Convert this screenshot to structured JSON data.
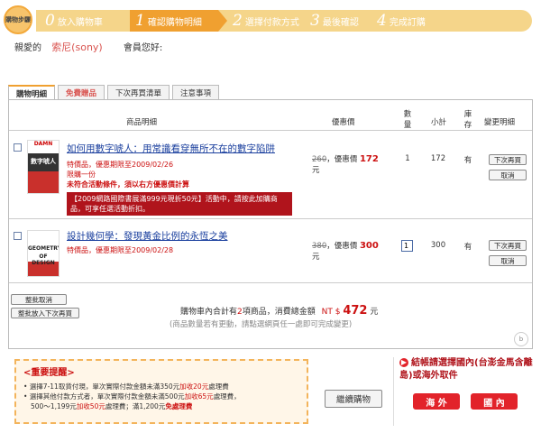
{
  "steps": {
    "badge": "購物步驟",
    "items": [
      {
        "num": "0",
        "label": "放入購物車"
      },
      {
        "num": "1",
        "label": "確認購物明細"
      },
      {
        "num": "2",
        "label": "選擇付款方式"
      },
      {
        "num": "3",
        "label": "最後確認"
      },
      {
        "num": "4",
        "label": "完成訂購"
      }
    ]
  },
  "greeting": {
    "prefix": "親愛的",
    "name": "索尼(sony)",
    "member": "會員您好:"
  },
  "tabs": [
    {
      "label": "購物明細"
    },
    {
      "label": "免費贈品"
    },
    {
      "label": "下次再買清單"
    },
    {
      "label": "注意事項"
    }
  ],
  "table": {
    "headers": {
      "product": "商品明細",
      "price": "優惠價",
      "qty": "數量",
      "subtotal": "小計",
      "stock": "庫存",
      "change": "變更明細"
    },
    "rows": [
      {
        "title": "如何用數字唬人：用常識看穿無所不在的數字陷阱",
        "special": "特價品，優惠期限至2009/02/26",
        "limit": "限購一份",
        "notice": "未符合活動條件，須以右方優惠價計算",
        "promo": "【2009網路國際書展滿999元現折50元】活動中，請按此加購商品，可享任選活動折扣。",
        "orig_price": "260",
        "price_prefix": "，優惠價",
        "price": "172",
        "price_unit": "元",
        "qty": "1",
        "subtotal": "172",
        "stock": "有",
        "buy_later": "下次再買",
        "cancel": "取消",
        "cover_line1": "DAMN",
        "cover_line2": "數字唬人"
      },
      {
        "title": "設計幾何學：發現黃金比例的永恆之美",
        "special": "特價品，優惠期限至2009/02/28",
        "orig_price": "380",
        "price_prefix": "，優惠價",
        "price": "300",
        "price_unit": "元",
        "qty": "1",
        "subtotal": "300",
        "stock": "有",
        "buy_later": "下次再買",
        "cancel": "取消",
        "cover_line1": "GEOMETRY",
        "cover_line2": "OF DESIGN"
      }
    ]
  },
  "bulk": {
    "cancel": "整批取消",
    "later": "整批放入下次再買"
  },
  "summary": {
    "text1": "購物車內合計有",
    "count": "2",
    "text2": "項商品，消費總金額",
    "currency": "NT $",
    "total": "472",
    "unit": "元",
    "note": "(商品數量若有更動，請點選網頁任一處即可完成變更)"
  },
  "reminder": {
    "title": "<重要提醒>",
    "line1a": "選擇7-11取貨付現，單次實際付款金額未滿350元",
    "line1b": "加收20元",
    "line1c": "處理費",
    "line2a": "選擇其他付款方式者，單次實際付款金額未滿500元",
    "line2b": "加收65元",
    "line2c": "處理費，",
    "line3a": "500～1,199元",
    "line3b": "加收50元",
    "line3c": "處理費；滿1,200元",
    "line3d": "免處理費"
  },
  "continue": "繼續購物",
  "checkout": {
    "title": "結帳請選擇國內(台澎金馬含離島)或海外取件",
    "overseas": "海 外",
    "domestic": "國 內"
  },
  "colors": {
    "accent": "#f0a030",
    "red": "#cc1111",
    "link": "#1a3f9e"
  }
}
